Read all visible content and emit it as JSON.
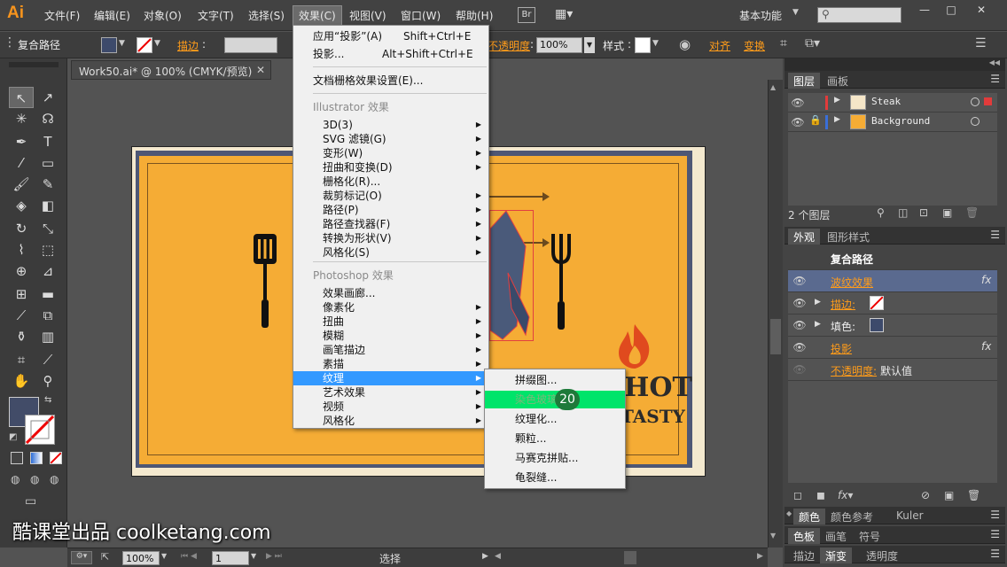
{
  "app": {
    "logo": "Ai"
  },
  "menubar": {
    "items": [
      "文件(F)",
      "编辑(E)",
      "对象(O)",
      "文字(T)",
      "选择(S)",
      "效果(C)",
      "视图(V)",
      "窗口(W)",
      "帮助(H)"
    ],
    "bridge": "Br",
    "workspace": "基本功能",
    "win_min": "—",
    "win_max": "□",
    "win_close": "✕"
  },
  "control": {
    "object_type": "复合路径",
    "stroke_label": "描边",
    "opacity_label": "不透明度",
    "opacity_value": "100%",
    "style_label": "样式",
    "align_label": "对齐",
    "transform_label": "变换"
  },
  "doc_tab": "Work50.ai* @ 100% (CMYK/预览)",
  "status": {
    "zoom": "100%",
    "page": "1",
    "tool": "选择"
  },
  "effect_menu": {
    "apply_last": "应用“投影”(A)",
    "apply_last_sc": "Shift+Ctrl+E",
    "last": "投影...",
    "last_sc": "Alt+Shift+Ctrl+E",
    "raster_settings": "文档栅格效果设置(E)...",
    "ai_header": "Illustrator 效果",
    "ai_items": [
      "3D(3)",
      "SVG 滤镜(G)",
      "变形(W)",
      "扭曲和变换(D)",
      "栅格化(R)...",
      "裁剪标记(O)",
      "路径(P)",
      "路径查找器(F)",
      "转换为形状(V)",
      "风格化(S)"
    ],
    "ps_header": "Photoshop 效果",
    "ps_items": [
      "效果画廊...",
      "像素化",
      "扭曲",
      "模糊",
      "画笔描边",
      "素描",
      "纹理",
      "艺术效果",
      "视频",
      "风格化"
    ]
  },
  "texture_submenu": {
    "items": [
      "拼缀图...",
      "染色玻璃...",
      "纹理化...",
      "颗粒...",
      "马赛克拼贴...",
      "龟裂缝..."
    ],
    "highlighted": "染色玻璃...",
    "step_badge": "20"
  },
  "layers_panel": {
    "tabs": [
      "图层",
      "画板"
    ],
    "layers": [
      {
        "name": "Steak",
        "color": "#e23b3b"
      },
      {
        "name": "Background",
        "color": "#3a6fd8"
      }
    ],
    "count": "2 个图层"
  },
  "appearance_panel": {
    "tabs": [
      "外观",
      "图形样式"
    ],
    "title": "复合路径",
    "rows": [
      "波纹效果",
      "描边:",
      "填色:",
      "投影",
      "不透明度:"
    ],
    "opacity_value": "默认值",
    "fx": "fx"
  },
  "color_panel": {
    "tabs": [
      "颜色",
      "颜色参考",
      "Kuler"
    ]
  },
  "brush_panel": {
    "tabs": [
      "色板",
      "画笔",
      "符号"
    ]
  },
  "stroke_panel": {
    "tabs": [
      "描边",
      "渐变",
      "透明度"
    ]
  },
  "artwork": {
    "text_hot": "HOT",
    "text_tasty": "TASTY"
  },
  "watermark": "酷课堂出品 coolketang.com"
}
